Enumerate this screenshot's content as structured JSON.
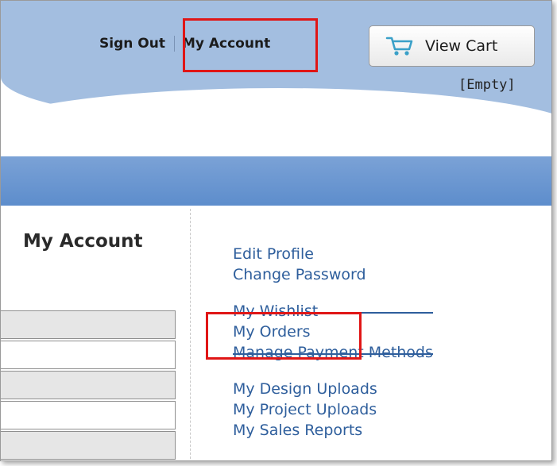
{
  "header": {
    "sign_out_label": "Sign Out",
    "my_account_label": "My Account",
    "cart_button_label": "View Cart",
    "cart_status": "[Empty]",
    "cart_icon": "shopping-cart-icon"
  },
  "sidebar": {
    "title": "My Account",
    "row_count": 5
  },
  "menu": {
    "groups": [
      {
        "items": [
          "Edit Profile",
          "Change Password"
        ]
      },
      {
        "items": [
          "My Wishlist",
          "My Orders",
          "Manage Payment Methods"
        ]
      },
      {
        "items": [
          "My Design Uploads",
          "My Project Uploads",
          "My Sales Reports"
        ]
      }
    ]
  },
  "colors": {
    "header_blue": "#a3bee0",
    "nav_blue": "#6d97d1",
    "link_blue": "#2e5e9c",
    "highlight_red": "#e01616"
  }
}
